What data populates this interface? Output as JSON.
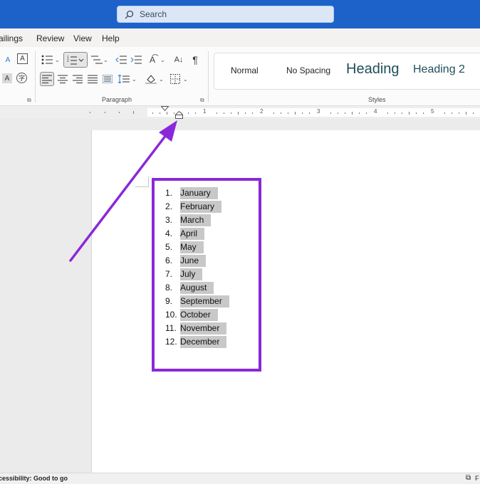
{
  "search": {
    "placeholder": "Search"
  },
  "tabs": [
    "ailings",
    "Review",
    "View",
    "Help"
  ],
  "ribbon": {
    "paragraph_label": "Paragraph",
    "styles_label": "Styles",
    "styles": [
      "Normal",
      "No Spacing",
      "Heading",
      "Heading 2"
    ]
  },
  "ruler": {
    "numbers": [
      "1",
      "2",
      "3",
      "4",
      "5"
    ]
  },
  "list": {
    "numbers": [
      "1.",
      "2.",
      "3.",
      "4.",
      "5.",
      "6.",
      "7.",
      "8.",
      "9.",
      "10.",
      "11.",
      "12."
    ],
    "items": [
      "January",
      "February",
      "March",
      "April",
      "May",
      "June",
      "July",
      "August",
      "September",
      "October",
      "November",
      "December"
    ]
  },
  "status": {
    "accessibility": "cessibility: Good to go",
    "focus_label": "F"
  },
  "colors": {
    "title_bar": "#1d62c9",
    "annotation": "#8a28d9",
    "selection": "#c8c8c8"
  }
}
